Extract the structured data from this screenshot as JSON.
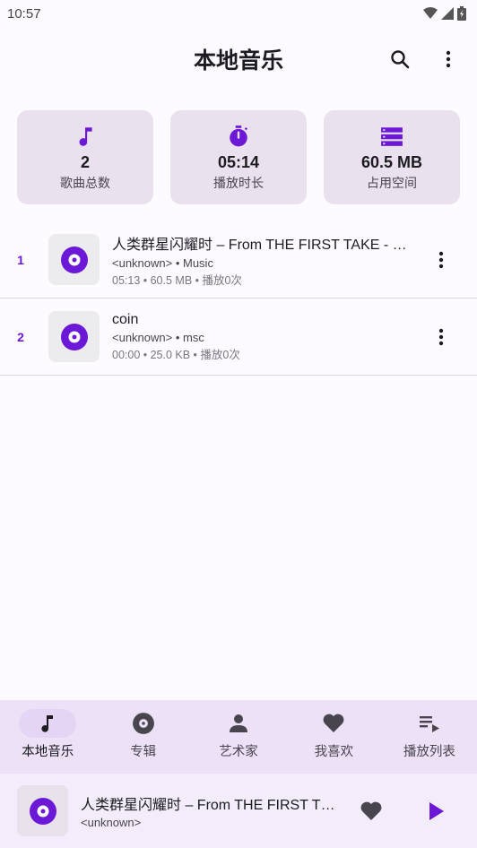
{
  "status_bar": {
    "time": "10:57"
  },
  "app_bar": {
    "title": "本地音乐"
  },
  "stats": [
    {
      "icon": "music-note-icon",
      "value": "2",
      "label": "歌曲总数"
    },
    {
      "icon": "timer-icon",
      "value": "05:14",
      "label": "播放时长"
    },
    {
      "icon": "storage-icon",
      "value": "60.5 MB",
      "label": "占用空间"
    }
  ],
  "songs": [
    {
      "index": "1",
      "title": "人类群星闪耀时 – From THE FIRST TAKE - …",
      "subtitle": "<unknown> • Music",
      "meta": "05:13 • 60.5 MB • 播放0次"
    },
    {
      "index": "2",
      "title": "coin",
      "subtitle": "<unknown> • msc",
      "meta": "00:00 • 25.0 KB • 播放0次"
    }
  ],
  "nav": [
    {
      "label": "本地音乐",
      "icon": "music-note-icon",
      "active": true
    },
    {
      "label": "专辑",
      "icon": "album-icon"
    },
    {
      "label": "艺术家",
      "icon": "person-icon"
    },
    {
      "label": "我喜欢",
      "icon": "heart-icon"
    },
    {
      "label": "播放列表",
      "icon": "playlist-icon"
    }
  ],
  "player": {
    "title": "人类群星闪耀时 – From THE FIRST T…",
    "artist": "<unknown>"
  },
  "colors": {
    "accent": "#6b19d6",
    "card_bg": "#e9e1ee",
    "nav_bg": "#ece1f7",
    "player_bg": "#f3ecfa"
  }
}
